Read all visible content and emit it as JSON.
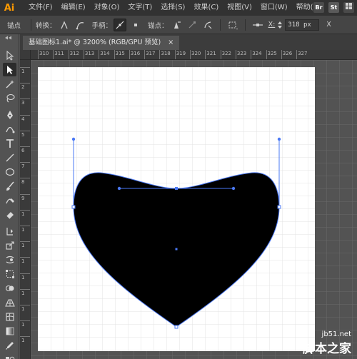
{
  "app": {
    "logo": "Ai"
  },
  "menu": {
    "items": [
      {
        "label": "文件(F)"
      },
      {
        "label": "编辑(E)"
      },
      {
        "label": "对象(O)"
      },
      {
        "label": "文字(T)"
      },
      {
        "label": "选择(S)"
      },
      {
        "label": "效果(C)"
      },
      {
        "label": "视图(V)"
      },
      {
        "label": "窗口(W)"
      },
      {
        "label": "帮助(H)"
      }
    ],
    "badges": {
      "br": "Br",
      "st": "St"
    }
  },
  "controlbar": {
    "anchor_title": "锚点",
    "convert_label": "转换：",
    "handle_label": "手柄：",
    "anchor_label": "锚点：",
    "x_label": "X:",
    "x_value": "318 px",
    "x_field_label": "X"
  },
  "document": {
    "tab_title": "基础图标1.ai* @ 3200% (RGB/GPU 预览)",
    "close_glyph": "×"
  },
  "rulers": {
    "top_labels": [
      "310",
      "311",
      "312",
      "313",
      "314",
      "315",
      "316",
      "317",
      "318",
      "319",
      "320",
      "321",
      "322",
      "323",
      "324",
      "325",
      "326",
      "327"
    ],
    "left_labels": [
      "1",
      "2",
      "3",
      "4",
      "5",
      "6",
      "7",
      "8",
      "9",
      "1",
      "1",
      "1",
      "1",
      "1",
      "1",
      "1",
      "1",
      "1"
    ]
  },
  "colors": {
    "shape_fill": "#000000",
    "path_stroke": "#4a78f5",
    "artboard": "#ffffff",
    "grid_minor": "#e3e3e3",
    "grid_major": "#d0d0d0",
    "pasteboard_grid": "#6a6a6a"
  },
  "watermark": {
    "small": "jb51.net",
    "big": "脚本之家"
  },
  "icons": {
    "selection": "selection-arrow-icon",
    "direct": "direct-selection-icon",
    "magic": "magic-wand-icon",
    "lasso": "lasso-icon",
    "pen": "pen-icon",
    "curvature": "curvature-icon",
    "type": "type-icon",
    "line": "line-segment-icon",
    "ellipse": "ellipse-icon",
    "brush": "paintbrush-icon",
    "shaper": "shaper-icon",
    "eraser": "eraser-icon",
    "rotate": "rotate-icon",
    "scale": "scale-icon",
    "warp": "warp-icon",
    "free-transform": "free-transform-icon",
    "shape-builder": "shape-builder-icon",
    "perspective": "perspective-icon",
    "mesh": "mesh-icon",
    "gradient": "gradient-icon",
    "eyedropper": "eyedropper-icon",
    "blend": "blend-icon",
    "symbol": "symbol-sprayer-icon",
    "graph": "graph-icon"
  }
}
